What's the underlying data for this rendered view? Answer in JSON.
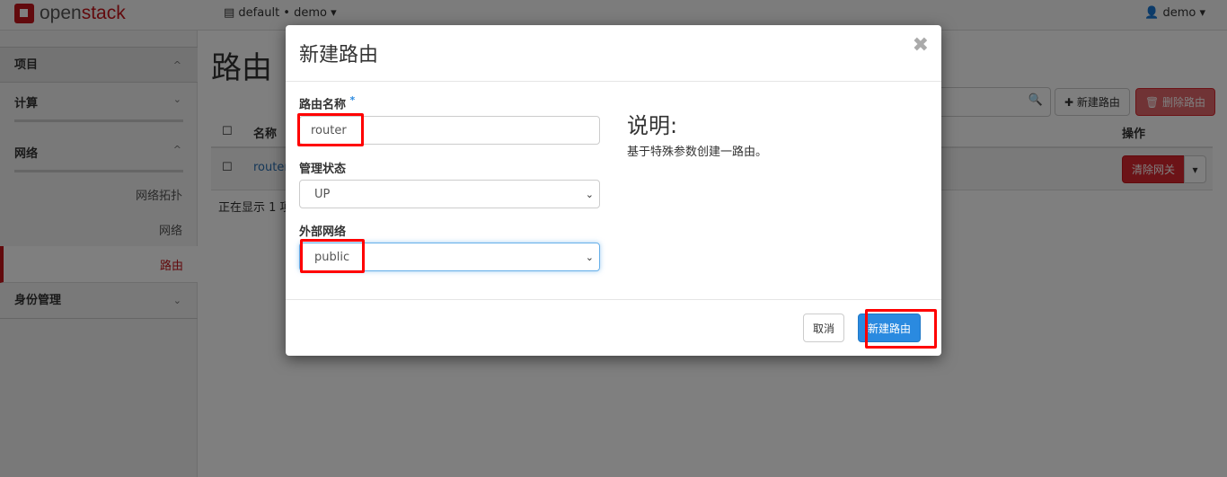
{
  "brand": {
    "name_a": "open",
    "name_b": "stack"
  },
  "header": {
    "project": "default • demo",
    "user": "demo"
  },
  "sidebar": {
    "sections": [
      {
        "label": "项目"
      },
      {
        "label": "计算"
      },
      {
        "label": "网络"
      },
      {
        "label": "身份管理"
      }
    ],
    "items": [
      {
        "label": "网络拓扑"
      },
      {
        "label": "网络"
      },
      {
        "label": "路由",
        "active": true
      }
    ]
  },
  "page": {
    "title": "路由",
    "create_button": "✚ 新建路由",
    "delete_button": "🗑 删除路由",
    "columns": [
      "名称",
      "操作"
    ],
    "rows": [
      {
        "name": "router",
        "action": "清除网关"
      }
    ],
    "footer": "正在显示 1 项"
  },
  "modal": {
    "title": "新建路由",
    "close": "✖",
    "name_label": "路由名称",
    "required": "*",
    "name_value": "router",
    "admin_label": "管理状态",
    "admin_value": "UP",
    "ext_label": "外部网络",
    "ext_value": "public",
    "help_title": "说明:",
    "help_text": "基于特殊参数创建一路由。",
    "cancel": "取消",
    "submit": "新建路由"
  },
  "colors": {
    "brand": "#c4141b",
    "primary": "#2a8ae0",
    "danger": "#d9272e",
    "highlight": "#ff0000"
  }
}
